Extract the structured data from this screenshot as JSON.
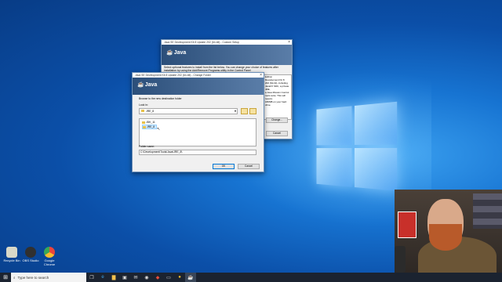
{
  "desktop": {
    "icons": [
      {
        "label": "Recycle Bin",
        "color": "#d8d8c8"
      },
      {
        "label": "OBS Studio",
        "color": "#303030"
      },
      {
        "label": "Google Chrome",
        "color": "#e8453c"
      }
    ]
  },
  "custom_setup": {
    "title": "Java SE Development Kit 8 Update 202 (64-bit) - Custom Setup",
    "logo_text": "Java",
    "description": "Select optional features to install from the list below. You can change your choice of features after installation by using the Add/Remove Programs utility in the Control Panel",
    "side_text": [
      "Edition",
      "Development Kit 8",
      "202 (64-bit), including",
      "JavaFX SDK, a private JRE,",
      "a Java Mission Control",
      "tools suite. This will require",
      "180MB on your hard drive."
    ],
    "change_button": "Change...",
    "cancel_button": "Cancel"
  },
  "change_folder": {
    "title": "Java SE Development Kit 8 Update 202 (64-bit) - Change Folder",
    "logo_text": "Java",
    "instruction": "Browse to the new destination folder",
    "look_in_label": "Look in:",
    "look_in_value": "JRE_8",
    "folders": [
      "JDK_11",
      "JRE_8"
    ],
    "selected_folder": "JRE_8",
    "folder_name_label": "Folder name:",
    "folder_name_value": "C:\\Development\\Tools\\Java\\JRE_8\\",
    "ok_button": "OK",
    "cancel_button": "Cancel"
  },
  "taskbar": {
    "search_placeholder": "Type here to search"
  }
}
